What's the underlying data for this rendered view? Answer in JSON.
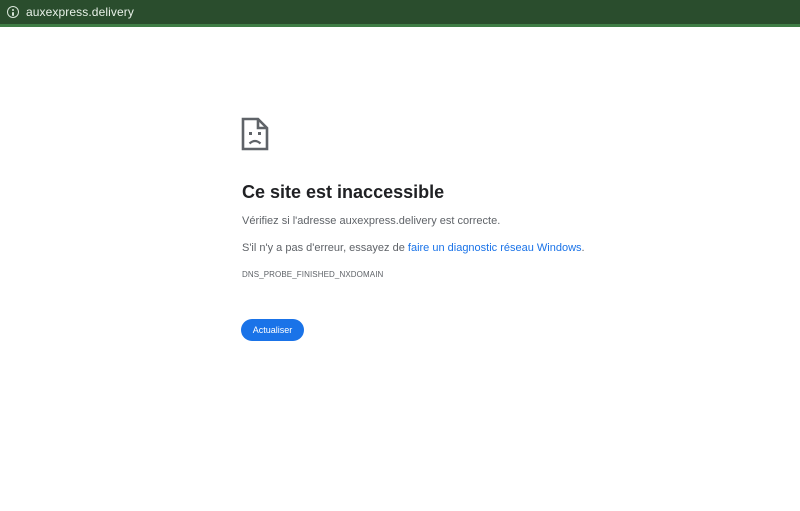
{
  "address_bar": {
    "icon": "info-icon",
    "url": "auxexpress.delivery"
  },
  "colors": {
    "bar_background": "#2a4d2d",
    "bar_accent": "#3f7d45",
    "link": "#1a73e8",
    "button": "#1a73e8",
    "title": "#202124",
    "body_text": "#5f6368"
  },
  "error_page": {
    "icon": "sad-page-icon",
    "title": "Ce site est inaccessible",
    "check_prefix": "Vérifiez si l'adresse ",
    "check_domain": "auxexpress.delivery",
    "check_suffix": " est correcte.",
    "hint_prefix": "S'il n'y a pas d'erreur, essayez de ",
    "hint_link": "faire un diagnostic réseau Windows",
    "hint_suffix": ".",
    "error_code": "DNS_PROBE_FINISHED_NXDOMAIN",
    "reload_label": "Actualiser"
  }
}
